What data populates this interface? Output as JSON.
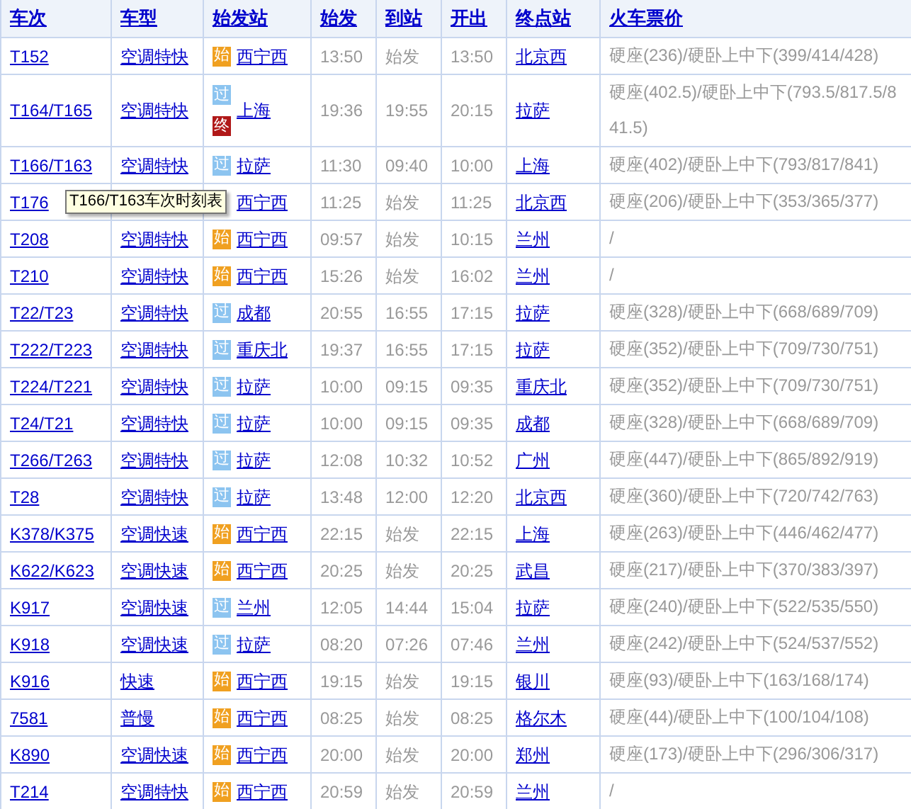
{
  "columns": [
    "车次",
    "车型",
    "始发站",
    "始发",
    "到站",
    "开出",
    "终点站",
    "火车票价"
  ],
  "rows": [
    {
      "train": "T152",
      "type": "空调特快",
      "badges": [
        {
          "kind": "start",
          "text": "始"
        }
      ],
      "origin": "西宁西",
      "start": "13:50",
      "arrive": "始发",
      "depart": "13:50",
      "terminus": "北京西",
      "price": "硬座(236)/硬卧上中下(399/414/428)"
    },
    {
      "train": "T164/T165",
      "type": "空调特快",
      "badges": [
        {
          "kind": "pass",
          "text": "过"
        },
        {
          "kind": "end",
          "text": "终"
        }
      ],
      "origin": "上海",
      "start": "19:36",
      "arrive": "19:55",
      "depart": "20:15",
      "terminus": "拉萨",
      "price": "硬座(402.5)/硬卧上中下(793.5/817.5/841.5)"
    },
    {
      "train": "T166/T163",
      "type": "空调特快",
      "badges": [
        {
          "kind": "pass",
          "text": "过"
        }
      ],
      "origin": "拉萨",
      "start": "11:30",
      "arrive": "09:40",
      "depart": "10:00",
      "terminus": "上海",
      "price": "硬座(402)/硬卧上中下(793/817/841)"
    },
    {
      "train": "T176",
      "origin": "西宁西",
      "start": "11:25",
      "arrive": "始发",
      "depart": "11:25",
      "terminus": "北京西",
      "price": "硬座(206)/硬卧上中下(353/365/377)"
    },
    {
      "train": "T208",
      "type": "空调特快",
      "badges": [
        {
          "kind": "start",
          "text": "始"
        }
      ],
      "origin": "西宁西",
      "start": "09:57",
      "arrive": "始发",
      "depart": "10:15",
      "terminus": "兰州",
      "price": "/"
    },
    {
      "train": "T210",
      "type": "空调特快",
      "badges": [
        {
          "kind": "start",
          "text": "始"
        }
      ],
      "origin": "西宁西",
      "start": "15:26",
      "arrive": "始发",
      "depart": "16:02",
      "terminus": "兰州",
      "price": "/"
    },
    {
      "train": "T22/T23",
      "type": "空调特快",
      "badges": [
        {
          "kind": "pass",
          "text": "过"
        }
      ],
      "origin": "成都",
      "start": "20:55",
      "arrive": "16:55",
      "depart": "17:15",
      "terminus": "拉萨",
      "price": "硬座(328)/硬卧上中下(668/689/709)"
    },
    {
      "train": "T222/T223",
      "type": "空调特快",
      "badges": [
        {
          "kind": "pass",
          "text": "过"
        }
      ],
      "origin": "重庆北",
      "start": "19:37",
      "arrive": "16:55",
      "depart": "17:15",
      "terminus": "拉萨",
      "price": "硬座(352)/硬卧上中下(709/730/751)"
    },
    {
      "train": "T224/T221",
      "type": "空调特快",
      "badges": [
        {
          "kind": "pass",
          "text": "过"
        }
      ],
      "origin": "拉萨",
      "start": "10:00",
      "arrive": "09:15",
      "depart": "09:35",
      "terminus": "重庆北",
      "price": "硬座(352)/硬卧上中下(709/730/751)"
    },
    {
      "train": "T24/T21",
      "type": "空调特快",
      "badges": [
        {
          "kind": "pass",
          "text": "过"
        }
      ],
      "origin": "拉萨",
      "start": "10:00",
      "arrive": "09:15",
      "depart": "09:35",
      "terminus": "成都",
      "price": "硬座(328)/硬卧上中下(668/689/709)"
    },
    {
      "train": "T266/T263",
      "type": "空调特快",
      "badges": [
        {
          "kind": "pass",
          "text": "过"
        }
      ],
      "origin": "拉萨",
      "start": "12:08",
      "arrive": "10:32",
      "depart": "10:52",
      "terminus": "广州",
      "price": "硬座(447)/硬卧上中下(865/892/919)"
    },
    {
      "train": "T28",
      "type": "空调特快",
      "badges": [
        {
          "kind": "pass",
          "text": "过"
        }
      ],
      "origin": "拉萨",
      "start": "13:48",
      "arrive": "12:00",
      "depart": "12:20",
      "terminus": "北京西",
      "price": "硬座(360)/硬卧上中下(720/742/763)"
    },
    {
      "train": "K378/K375",
      "type": "空调快速",
      "badges": [
        {
          "kind": "start",
          "text": "始"
        }
      ],
      "origin": "西宁西",
      "start": "22:15",
      "arrive": "始发",
      "depart": "22:15",
      "terminus": "上海",
      "price": "硬座(263)/硬卧上中下(446/462/477)"
    },
    {
      "train": "K622/K623",
      "type": "空调快速",
      "badges": [
        {
          "kind": "start",
          "text": "始"
        }
      ],
      "origin": "西宁西",
      "start": "20:25",
      "arrive": "始发",
      "depart": "20:25",
      "terminus": "武昌",
      "price": "硬座(217)/硬卧上中下(370/383/397)"
    },
    {
      "train": "K917",
      "type": "空调快速",
      "badges": [
        {
          "kind": "pass",
          "text": "过"
        }
      ],
      "origin": "兰州",
      "start": "12:05",
      "arrive": "14:44",
      "depart": "15:04",
      "terminus": "拉萨",
      "price": "硬座(240)/硬卧上中下(522/535/550)"
    },
    {
      "train": "K918",
      "type": "空调快速",
      "badges": [
        {
          "kind": "pass",
          "text": "过"
        }
      ],
      "origin": "拉萨",
      "start": "08:20",
      "arrive": "07:26",
      "depart": "07:46",
      "terminus": "兰州",
      "price": "硬座(242)/硬卧上中下(524/537/552)"
    },
    {
      "train": "K916",
      "type": "快速",
      "badges": [
        {
          "kind": "start",
          "text": "始"
        }
      ],
      "origin": "西宁西",
      "start": "19:15",
      "arrive": "始发",
      "depart": "19:15",
      "terminus": "银川",
      "price": "硬座(93)/硬卧上中下(163/168/174)"
    },
    {
      "train": "7581",
      "type": "普慢",
      "badges": [
        {
          "kind": "start",
          "text": "始"
        }
      ],
      "origin": "西宁西",
      "start": "08:25",
      "arrive": "始发",
      "depart": "08:25",
      "terminus": "格尔木",
      "price": "硬座(44)/硬卧上中下(100/104/108)"
    },
    {
      "train": "K890",
      "type": "空调快速",
      "badges": [
        {
          "kind": "start",
          "text": "始"
        }
      ],
      "origin": "西宁西",
      "start": "20:00",
      "arrive": "始发",
      "depart": "20:00",
      "terminus": "郑州",
      "price": "硬座(173)/硬卧上中下(296/306/317)"
    },
    {
      "train": "T214",
      "type": "空调特快",
      "badges": [
        {
          "kind": "start",
          "text": "始"
        }
      ],
      "origin": "西宁西",
      "start": "20:59",
      "arrive": "始发",
      "depart": "20:59",
      "terminus": "兰州",
      "price": "/"
    }
  ],
  "tooltip": {
    "text": "T166/T163车次时刻表"
  }
}
